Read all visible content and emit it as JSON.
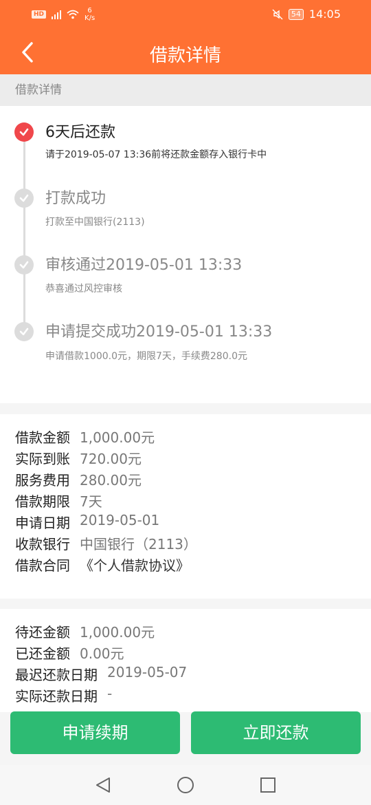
{
  "status_bar": {
    "hd": "HD",
    "network": "4G",
    "speed_value": "6",
    "speed_unit": "K/s",
    "battery": "54",
    "time": "14:05"
  },
  "nav": {
    "back_icon": "chevron-left-icon",
    "title": "借款详情"
  },
  "section_label": "借款详情",
  "timeline": [
    {
      "title": "6天后还款",
      "desc": "请于2019-05-07 13:36前将还款金额存入银行卡中",
      "state": "active"
    },
    {
      "title": "打款成功",
      "desc": "打款至中国银行(2113)",
      "state": "done"
    },
    {
      "title": "审核通过2019-05-01 13:33",
      "desc": "恭喜通过风控审核",
      "state": "done"
    },
    {
      "title": "申请提交成功2019-05-01 13:33",
      "desc": "申请借款1000.0元，期限7天，手续费280.0元",
      "state": "done"
    }
  ],
  "loan_info": [
    {
      "label": "借款金额",
      "value": "1,000.00元"
    },
    {
      "label": "实际到账",
      "value": "720.00元"
    },
    {
      "label": "服务费用",
      "value": "280.00元"
    },
    {
      "label": "借款期限",
      "value": "7天"
    },
    {
      "label": "申请日期",
      "value": "2019-05-01"
    },
    {
      "label": "收款银行",
      "value": "中国银行（2113）"
    },
    {
      "label": "借款合同",
      "value": "《个人借款协议》"
    }
  ],
  "repay_info": [
    {
      "label": "待还金额",
      "value": "1,000.00元"
    },
    {
      "label": "已还金额",
      "value": "0.00元"
    },
    {
      "label": "最迟还款日期",
      "value": "2019-05-07"
    },
    {
      "label": "实际还款日期",
      "value": "-"
    }
  ],
  "buttons": {
    "renew": "申请续期",
    "repay": "立即还款"
  },
  "colors": {
    "brand": "#ff7133",
    "active": "#f0474b",
    "button": "#2dbb73"
  }
}
